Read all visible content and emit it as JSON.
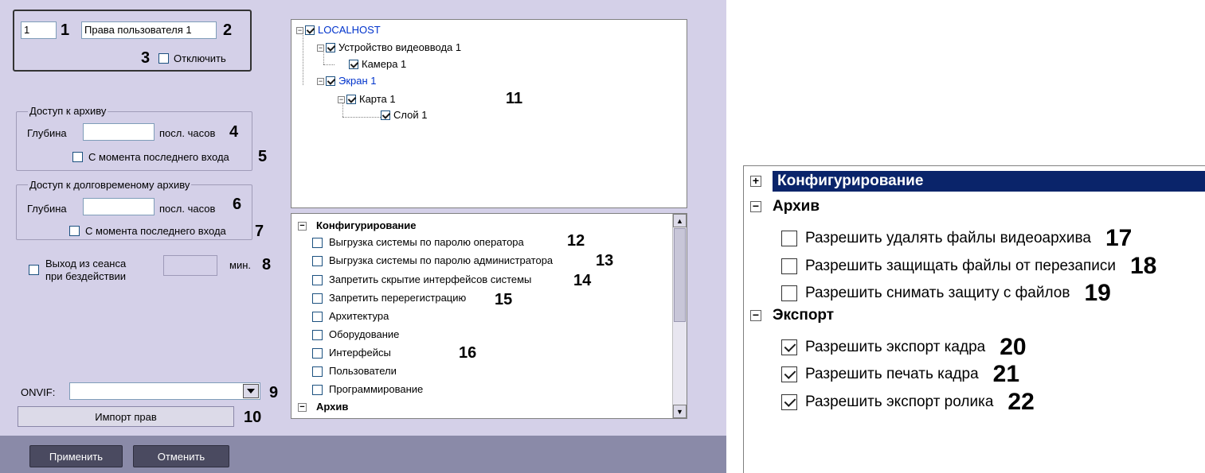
{
  "user": {
    "id": "1",
    "name": "Права пользователя 1",
    "disable_label": "Отключить"
  },
  "archive": {
    "group_title": "Доступ к архиву",
    "depth_label": "Глубина",
    "hours_label": "посл. часов",
    "since_last_label": "С момента последнего входа"
  },
  "long_archive": {
    "group_title": "Доступ к долговременому архиву",
    "depth_label": "Глубина",
    "hours_label": "посл. часов",
    "since_last_label": "С момента последнего входа"
  },
  "session": {
    "label_line1": "Выход из сеанса",
    "label_line2": "при бездействии",
    "minutes_label": "мин."
  },
  "onvif": {
    "label": "ONVIF:",
    "value": ""
  },
  "buttons": {
    "import": "Импорт прав",
    "apply": "Применить",
    "cancel": "Отменить"
  },
  "tree": [
    {
      "label": "LOCALHOST",
      "checked": true,
      "color": "#0033cc"
    },
    {
      "label": "Устройство видеоввода 1",
      "checked": true,
      "color": "#000000"
    },
    {
      "label": "Камера 1",
      "checked": true,
      "color": "#000000"
    },
    {
      "label": "Экран 1",
      "checked": true,
      "color": "#0033cc"
    },
    {
      "label": "Карта 1",
      "checked": true,
      "color": "#000000"
    },
    {
      "label": "Слой 1",
      "checked": true,
      "color": "#000000"
    }
  ],
  "permissions": {
    "section_config": "Конфигурирование",
    "items": [
      "Выгрузка системы по паролю оператора",
      "Выгрузка системы по паролю администратора",
      "Запретить скрытие интерфейсов системы",
      "Запретить перерегистрацию",
      "Архитектура",
      "Оборудование",
      "Интерфейсы",
      "Пользователи",
      "Программирование"
    ],
    "section_archive": "Архив"
  },
  "right": {
    "section_config": "Конфигурирование",
    "section_archive": "Архив",
    "archive_items": [
      "Разрешить удалять файлы видеоархива",
      "Разрешить защищать файлы от перезаписи",
      "Разрешить снимать защиту с файлов"
    ],
    "section_export": "Экспорт",
    "export_items": [
      "Разрешить экспорт кадра",
      "Разрешить печать кадра",
      "Разрешить экспорт ролика"
    ]
  },
  "callouts": {
    "n1": "1",
    "n2": "2",
    "n3": "3",
    "n4": "4",
    "n5": "5",
    "n6": "6",
    "n7": "7",
    "n8": "8",
    "n9": "9",
    "n10": "10",
    "n11": "11",
    "n12": "12",
    "n13": "13",
    "n14": "14",
    "n15": "15",
    "n16": "16",
    "n17": "17",
    "n18": "18",
    "n19": "19",
    "n20": "20",
    "n21": "21",
    "n22": "22"
  }
}
